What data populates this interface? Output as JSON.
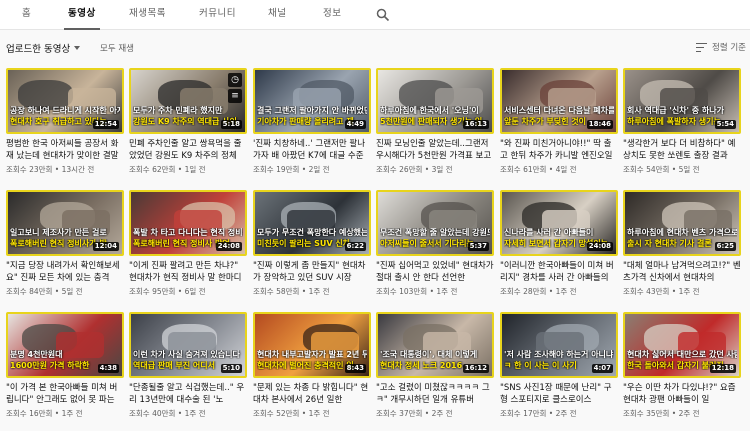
{
  "tabs": [
    {
      "label": "홈",
      "active": false
    },
    {
      "label": "동영상",
      "active": true
    },
    {
      "label": "재생목록",
      "active": false
    },
    {
      "label": "커뮤니티",
      "active": false
    },
    {
      "label": "채널",
      "active": false
    },
    {
      "label": "정보",
      "active": false
    }
  ],
  "subbar": {
    "uploads_label": "업로드한 동영상",
    "play_all_label": "모두 재생",
    "sort_label": "정렬 기준"
  },
  "hover_icons": [
    "clock-icon",
    "queue-icon"
  ],
  "videos": [
    {
      "caption": "공장 하나여 드라니게 시작한 아저씨들 시",
      "caption2": "현대차 호구 취급하고 있다는",
      "duration": "12:54",
      "title": "평범한 한국 아저씨들 공장서 화재 났는데 현대차가 맞이한 결말",
      "meta": "조회수 23만회 • 13시간 전",
      "colors": [
        "#6a6257",
        "#c8b49a",
        "#3b3b3b"
      ]
    },
    {
      "caption": "모두가 주차 민폐라 했지만",
      "caption2": "강원도 K9 차주의 역대급 사이",
      "duration": "5:18",
      "title": "민폐 주차인줄 알고 쌍욕먹을 줄 았었던 강원도 K9 차주의 정체",
      "meta": "조회수 62만회 • 1일 전",
      "colors": [
        "#d7d3cc",
        "#8a7e6e",
        "#2a2a2a"
      ]
    },
    {
      "caption": "결국 그랜저 팔아가지 안 바뀌었던",
      "caption2": "기아차가 판매량 올리려고 제",
      "duration": "4:49",
      "title": "'진짜 치창하네..' 그랜저만 팔나가자 배 아팠던 K7에 대글 수준",
      "meta": "조회수 19만회 • 2일 전",
      "colors": [
        "#2f3a4a",
        "#9aa4b0",
        "#505a66"
      ]
    },
    {
      "caption": "하루아침에 한국에서 '오닝'이",
      "caption2": "5천만원에 판매되자 생기는 일",
      "duration": "16:13",
      "title": "진짜 모닝인줄 알았는데..그랜저 우시해다가 5천만원 가격표 보고",
      "meta": "조회수 26만회 • 3일 전",
      "colors": [
        "#e8e6e2",
        "#9d9a95",
        "#4c4c4c"
      ]
    },
    {
      "caption": "서비스센터 다녀온 다음날 폐차를",
      "caption2": "앞둔 차주가 부딪힌 것이",
      "duration": "18:46",
      "title": "\"와 진짜 미친거아니야!!\" 딱 출고 한뒤 차주가 카니발 엔진오일 갈리",
      "meta": "조회수 61만회 • 4일 전",
      "colors": [
        "#3a2d2d",
        "#b8a08e",
        "#6a4038"
      ]
    },
    {
      "caption": "회사 역대급 '신차' 중 하나가",
      "caption2": "하루아침에 폭발하자 생기는",
      "duration": "5:54",
      "title": "\"생각한거 보다 더 비참하다\" 예상치도 못한 쏘렌토 출장 결과",
      "meta": "조회수 54만회 • 5일 전",
      "colors": [
        "#9a9189",
        "#4f4b47",
        "#c6bdb3"
      ]
    },
    {
      "caption": "일고보니 제조사가 만든 걸로",
      "caption2": "폭로해버린 현직 정비사가 발",
      "duration": "12:04",
      "title": "\"지금 당장 내려가서 확인해보세요\" 진짜 모든 차에 있는 충격",
      "meta": "조회수 84만회 • 5일 전",
      "colors": [
        "#2b2b2b",
        "#7a6e62",
        "#b3a89a"
      ]
    },
    {
      "caption": "폭발 차 타고 다니다는 현직 정비사가",
      "caption2": "폭로해버린 현직 정비사 발언",
      "duration": "24:08",
      "title": "\"이게 진짜 팔려고 만든 차냐?\" 현대차가 현직 정비사 말 한마디에",
      "meta": "조회수 95만회 • 6일 전",
      "colors": [
        "#4a3a36",
        "#c0403a",
        "#d8c0a8"
      ]
    },
    {
      "caption": "모두가 무조건 폭망한다 예상했는데",
      "caption2": "미친듯이 팔리는 SUV 신차",
      "duration": "6:22",
      "title": "\"진짜 이렇게 좀 만들지\" 현대차가 장악하고 있던 SUV 시장",
      "meta": "조회수 58만회 • 1주 전",
      "colors": [
        "#6b7278",
        "#2d3238",
        "#a9b0b6"
      ]
    },
    {
      "caption": "무조건 폭망할 줄 알았는데 강원도",
      "caption2": "아저씨들이 줄서서 기다리는",
      "duration": "5:37",
      "title": "\"진짜 십어먹고 있었네\" 현대차가 절대 출시 안 한다 선언한",
      "meta": "조회수 103만회 • 1주 전",
      "colors": [
        "#dedcd8",
        "#8b8780",
        "#55524e"
      ]
    },
    {
      "caption": "신나라를 사러 간 아빠들이",
      "caption2": "자세히 보면서 갑자기 망설이는",
      "duration": "24:08",
      "title": "\"이러니깐 한국아빠들이 미쳐 버리지\" 경차를 사러 간 아빠들의",
      "meta": "조회수 28만회 • 1주 전",
      "colors": [
        "#5a5650",
        "#d8d0c4",
        "#2a2826"
      ]
    },
    {
      "caption": "하루아침에 현대차 벤츠 가격으로",
      "caption2": "출시 자 현대차 기사 결론",
      "duration": "6:25",
      "title": "\"대체 얼마나 남겨먹으려고!?\" 벤츠가격 신차에서 현대차의",
      "meta": "조회수 43만회 • 1주 전",
      "colors": [
        "#2e2a27",
        "#786f65",
        "#cfc6ba"
      ]
    },
    {
      "caption": "분명 4천만원대",
      "caption2": "1600만원 가격 하락한",
      "duration": "4:38",
      "title": "\"이 가격 본 한국아빠들 미쳐 버립니다\" 안그래도 없어 못 파는",
      "meta": "조회수 16만회 • 1주 전",
      "colors": [
        "#e6e4e0",
        "#b03030",
        "#4a4844"
      ]
    },
    {
      "caption": "이런 차가 사실 숨겨져 있습니다",
      "caption2": "역대급 판매 부진 어디서",
      "duration": "5:10",
      "title": "\"단종될줄 알고 식겁했는데..\" 우리 13년만에 대수술 된 '노",
      "meta": "조회수 40만회 • 1주 전",
      "colors": [
        "#3c4048",
        "#8a8e96",
        "#d2d4d8"
      ]
    },
    {
      "caption": "현대차 내부고발자가 발표 2년 뒤",
      "caption2": "현대차에 벌어진 충격적인 일",
      "duration": "8:43",
      "title": "\"문제 있는 차종 다 밝힙니다\" 현대차 본사에서 26년 일한",
      "meta": "조회수 52만회 • 1주 전",
      "colors": [
        "#b44a20",
        "#f0a040",
        "#3a2418"
      ]
    },
    {
      "caption": "'조국 대통령이', 대체 이렇게",
      "caption2": "현대차 정세 노크 2016",
      "duration": "16:12",
      "title": "\"고소 걸렸이 미쳤잖ㅋㅋㅋㅋ 그 ㅋ\" 개무시하던 일개 유튜버",
      "meta": "조회수 37만회 • 2주 전",
      "colors": [
        "#3a3a40",
        "#c8b8a8",
        "#7a7064"
      ]
    },
    {
      "caption": "'저 사람 조사해야 하는거 아니냐'",
      "caption2": "ㅋ 한 이 사는 이 사기",
      "duration": "4:07",
      "title": "\"SNS 사진1장 때문에 난리\" 구형 스포티지로 클스로이스",
      "meta": "조회수 17만회 • 2주 전",
      "colors": [
        "#20242a",
        "#6a7078",
        "#a0a8b0"
      ]
    },
    {
      "caption": "현대차 싫어서 대만으로 갔던 사람들",
      "caption2": "한국 돌아와서 갑자기 불러진",
      "duration": "12:18",
      "title": "\"우슨 이딴 차가 다있냐!?\" 요즘 현대차 광팬 아빠들이 일",
      "meta": "조회수 35만회 • 2주 전",
      "colors": [
        "#8a7e72",
        "#c02a2a",
        "#d8d0c6"
      ]
    }
  ]
}
